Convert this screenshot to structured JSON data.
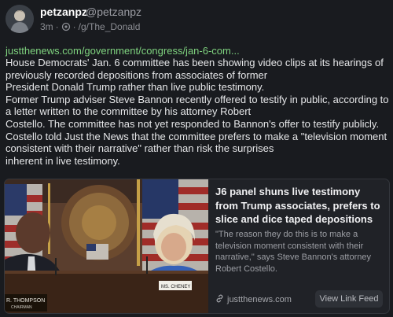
{
  "author": {
    "name": "petzanpz",
    "handle": "@petzanpz"
  },
  "meta": {
    "time": "3m",
    "separator": "·",
    "feed": "/g/The_Donald",
    "repost_icon": "repost-icon"
  },
  "post": {
    "link_text": "justthenews.com/government/congress/jan-6-com...",
    "lines": [
      "House Democrats' Jan. 6 committee has been showing video clips at its hearings of previously recorded depositions from associates of former",
      "President Donald Trump rather than live public testimony.",
      "Former Trump adviser Steve Bannon recently offered to testify in public, according to a letter written to the committee by his attorney Robert",
      "Costello. The committee has not yet responded to Bannon's offer to testify publicly.",
      "Costello told Just the News that the committee prefers to make a \"television moment consistent with their narrative\" rather than risk the surprises",
      "inherent in live testimony."
    ]
  },
  "card": {
    "title": "J6 panel shuns live testimony from Trump associates, prefers to slice and dice taped depositions",
    "description": "\"The reason they do this is to make a television moment consistent with their narrative,\" says Steve Bannon's attorney Robert Costello.",
    "domain": "justthenews.com",
    "button_label": "View Link Feed",
    "image": {
      "nameplate_left_1": "R. THOMPSON",
      "nameplate_left_2": "CHAIRMAN",
      "nameplate_right": "MS. CHENEY"
    }
  },
  "colors": {
    "background": "#191b1f",
    "link": "#7fd37f",
    "card_bg": "#202227"
  }
}
